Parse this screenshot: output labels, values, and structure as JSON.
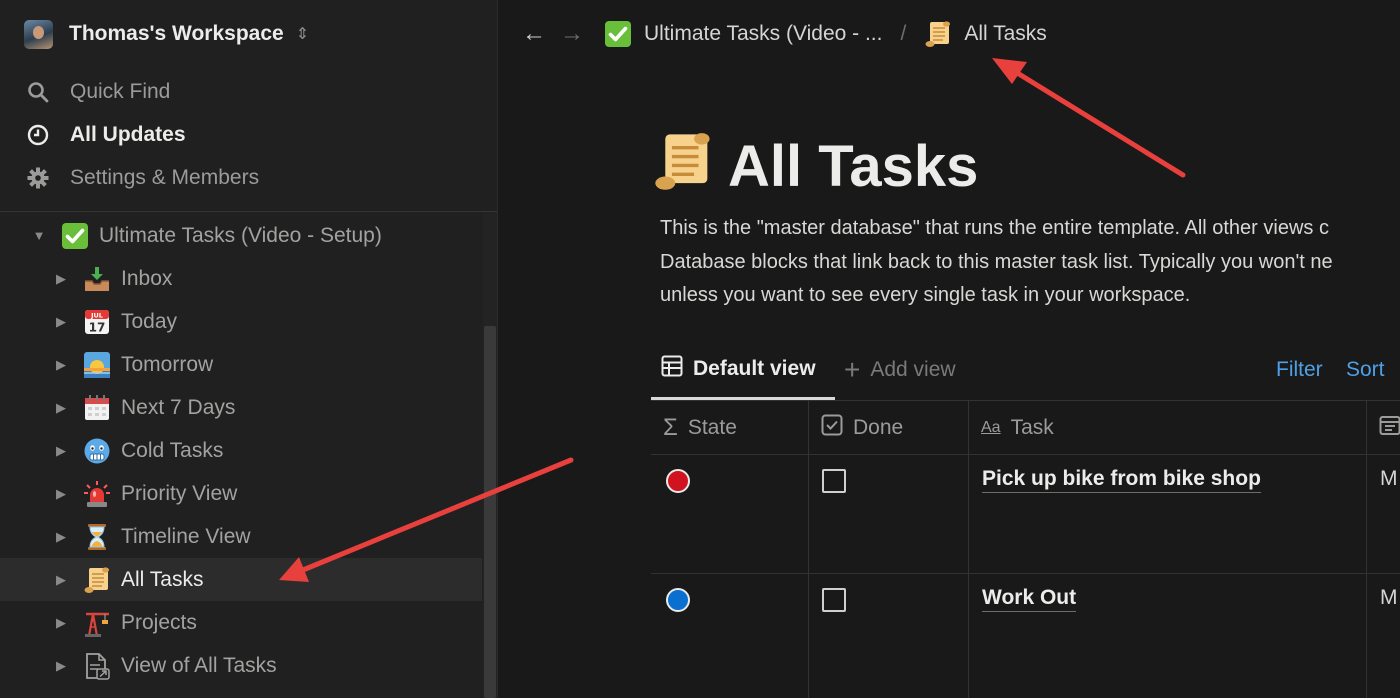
{
  "workspace": {
    "name": "Thomas's Workspace"
  },
  "nav": {
    "quick_find": "Quick Find",
    "all_updates": "All Updates",
    "settings": "Settings & Members"
  },
  "tree": {
    "root": "Ultimate Tasks (Video - Setup)",
    "items": [
      {
        "label": "Inbox",
        "icon": "inbox-tray-icon"
      },
      {
        "label": "Today",
        "icon": "calendar-jul17-icon"
      },
      {
        "label": "Tomorrow",
        "icon": "sunrise-icon"
      },
      {
        "label": "Next 7 Days",
        "icon": "spiral-calendar-icon"
      },
      {
        "label": "Cold Tasks",
        "icon": "cold-face-icon"
      },
      {
        "label": "Priority View",
        "icon": "siren-icon"
      },
      {
        "label": "Timeline View",
        "icon": "hourglass-icon"
      },
      {
        "label": "All Tasks",
        "icon": "scroll-icon"
      },
      {
        "label": "Projects",
        "icon": "crane-icon"
      },
      {
        "label": "View of All Tasks",
        "icon": "linked-page-icon"
      }
    ]
  },
  "breadcrumb": {
    "parent": "Ultimate Tasks (Video - ...",
    "separator": "/",
    "current": "All Tasks"
  },
  "page": {
    "title": "All Tasks",
    "description_lines": [
      "This is the \"master database\" that runs the entire template. All other views c",
      "Database blocks that link back to this master task list. Typically you won't ne",
      "unless you want to see every single task in your workspace."
    ]
  },
  "views": {
    "default": "Default view",
    "add": "Add view",
    "filter": "Filter",
    "sort": "Sort"
  },
  "table": {
    "columns": [
      "State",
      "Done",
      "Task"
    ],
    "rows": [
      {
        "state_color": "#d0131f",
        "done": false,
        "task": "Pick up bike from bike shop",
        "overflow": "M"
      },
      {
        "state_color": "#0a6fcf",
        "done": false,
        "task": "Work Out",
        "overflow": "M"
      }
    ]
  },
  "colors": {
    "accent": "#4ea0e6",
    "annotation_arrow": "#e8403c",
    "sidebar_bg": "#202020",
    "main_bg": "#191919"
  }
}
